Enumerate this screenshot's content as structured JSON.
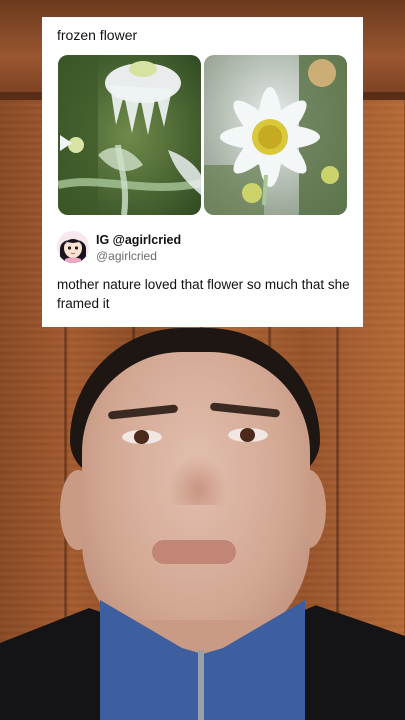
{
  "post": {
    "title": "frozen flower",
    "author_name": "IG @agirlcried",
    "author_handle": "@agirlcried",
    "text": "mother nature loved that flower so much that she framed it"
  },
  "icons": {
    "avatar": "cartoon-girl-avatar"
  },
  "colors": {
    "card_background": "#ffffff",
    "wood_background": "#a65c30",
    "jacket_collar": "#3d5f9f"
  }
}
